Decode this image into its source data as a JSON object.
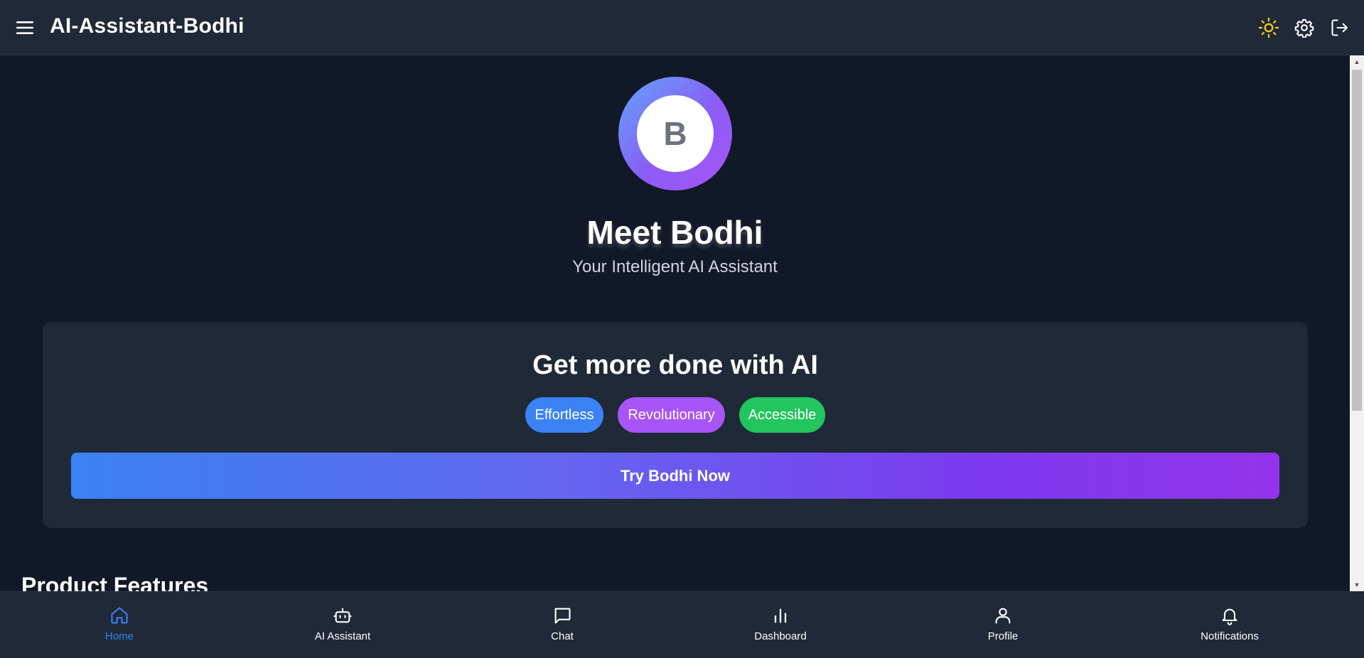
{
  "app": {
    "title": "AI-Assistant-Bodhi"
  },
  "header": {
    "icons": [
      "menu-icon",
      "sun-icon",
      "gear-icon",
      "logout-icon"
    ],
    "sun_color": "#facc15"
  },
  "hero": {
    "avatar_letter": "B",
    "title": "Meet Bodhi",
    "subtitle": "Your Intelligent AI Assistant"
  },
  "card": {
    "title": "Get more done with AI",
    "pills": [
      {
        "label": "Effortless",
        "color": "#3b82f6"
      },
      {
        "label": "Revolutionary",
        "color": "#a855f7"
      },
      {
        "label": "Accessible",
        "color": "#22c55e"
      }
    ],
    "cta_label": "Try Bodhi Now"
  },
  "sections": {
    "features_heading": "Product Features"
  },
  "bottom_nav": {
    "active": "Home",
    "active_color": "#3b82f6",
    "items": [
      {
        "label": "Home",
        "icon": "home-icon"
      },
      {
        "label": "AI Assistant",
        "icon": "robot-icon"
      },
      {
        "label": "Chat",
        "icon": "chat-icon"
      },
      {
        "label": "Dashboard",
        "icon": "bar-chart-icon"
      },
      {
        "label": "Profile",
        "icon": "user-icon"
      },
      {
        "label": "Notifications",
        "icon": "bell-icon"
      }
    ]
  }
}
